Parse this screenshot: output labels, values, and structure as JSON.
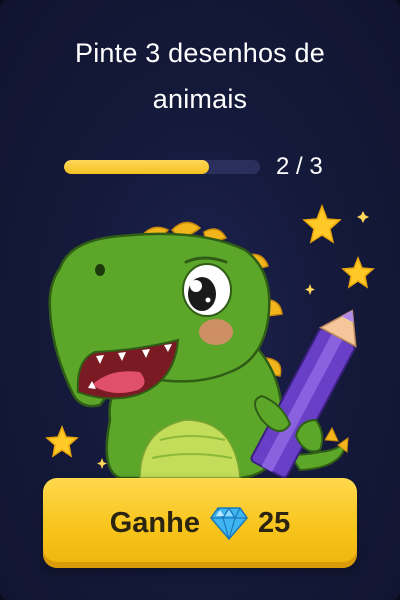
{
  "task": {
    "title": "Pinte 3 desenhos de animais"
  },
  "progress": {
    "current": 2,
    "total": 3,
    "fraction": 0.74,
    "label": "2 / 3"
  },
  "reward": {
    "label": "Ganhe",
    "amount": "25",
    "icon": "diamond-icon"
  },
  "illustration": {
    "subject": "dinosaur-with-pencil"
  },
  "colors": {
    "background": "#151a3c",
    "accent": "#f8c51c",
    "progress_track": "#2a2f5c",
    "dino_green": "#5ca72a",
    "pencil_purple": "#6a3fc8"
  }
}
